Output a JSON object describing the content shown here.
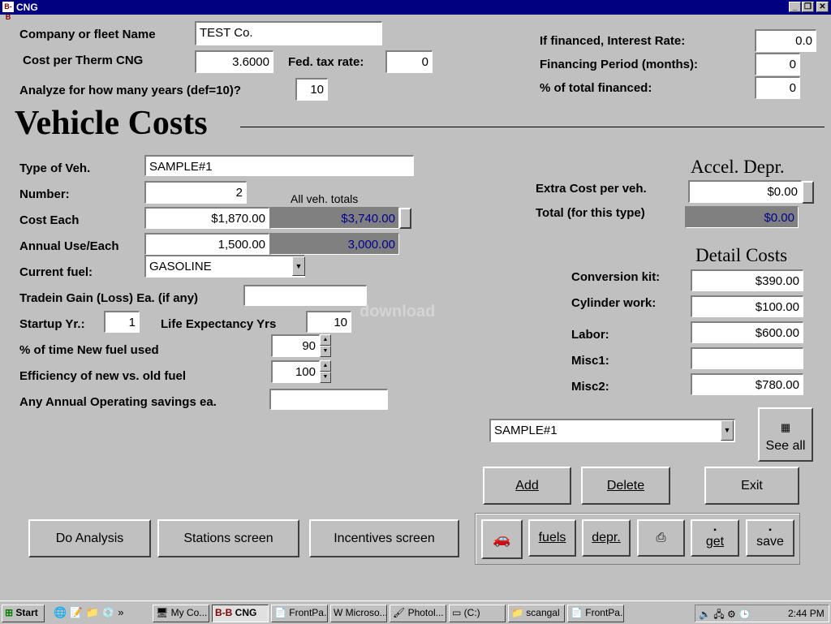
{
  "window": {
    "title": "CNG",
    "app_icon": "B-B"
  },
  "top_left": {
    "company_label": "Company or fleet Name",
    "company_value": "TEST Co.",
    "therm_label": "Cost per Therm CNG",
    "therm_value": "3.6000",
    "tax_label": "Fed. tax rate:",
    "tax_value": "0",
    "years_label": "Analyze for how many years (def=10)?",
    "years_value": "10"
  },
  "financing": {
    "rate_label": "If financed, Interest Rate:",
    "rate_value": "0.0",
    "period_label": "Financing Period (months):",
    "period_value": "0",
    "pct_label": "% of total financed:",
    "pct_value": "0"
  },
  "vehicle": {
    "heading": "Vehicle Costs",
    "type_label": "Type of Veh.",
    "type_value": "SAMPLE#1",
    "number_label": "Number:",
    "number_value": "2",
    "totals_label": "All veh. totals",
    "cost_label": "Cost Each",
    "cost_value": "$1,870.00",
    "cost_total": "$3,740.00",
    "use_label": "Annual Use/Each",
    "use_value": "1,500.00",
    "use_total": "3,000.00",
    "fuel_label": "Current fuel:",
    "fuel_value": "GASOLINE",
    "tradein_label": "Tradein Gain (Loss) Ea. (if any)",
    "tradein_value": "",
    "startup_label": "Startup Yr.:",
    "startup_value": "1",
    "life_label": "Life Expectancy Yrs",
    "life_value": "10",
    "pct_new_label": "% of time New fuel used",
    "pct_new_value": "90",
    "eff_label": "Efficiency of new vs. old fuel",
    "eff_value": "100",
    "savings_label": "Any Annual Operating savings ea.",
    "savings_value": ""
  },
  "accel": {
    "heading": "Accel. Depr.",
    "extra_label": "Extra Cost per veh.",
    "extra_value": "$0.00",
    "total_label": "Total (for this type)",
    "total_value": "$0.00"
  },
  "detail": {
    "heading": "Detail Costs",
    "conv_label": "Conversion kit:",
    "conv_value": "$390.00",
    "cyl_label": "Cylinder work:",
    "cyl_value": "$100.00",
    "labor_label": "Labor:",
    "labor_value": "$600.00",
    "misc1_label": "Misc1:",
    "misc1_value": "",
    "misc2_label": "Misc2:",
    "misc2_value": "$780.00"
  },
  "selector": {
    "value": "SAMPLE#1",
    "see_all": "See all"
  },
  "actions": {
    "add": "Add",
    "delete": "Delete",
    "exit": "Exit",
    "analysis": "Do Analysis",
    "stations": "Stations screen",
    "incentives": "Incentives screen"
  },
  "toolbar": {
    "fuels": "fuels",
    "depr": "depr.",
    "get": "get",
    "save": "save"
  },
  "watermark": "download",
  "taskbar": {
    "start": "Start",
    "tasks": [
      "My Co...",
      "CNG",
      "FrontPa...",
      "Microso...",
      "Photol...",
      "(C:)",
      "scangal",
      "FrontPa..."
    ],
    "clock": "2:44 PM"
  },
  "colors": {
    "titlebar": "#000080",
    "readonly_bg": "#808080",
    "readonly_text": "#000090",
    "face": "#c0c0c0"
  }
}
